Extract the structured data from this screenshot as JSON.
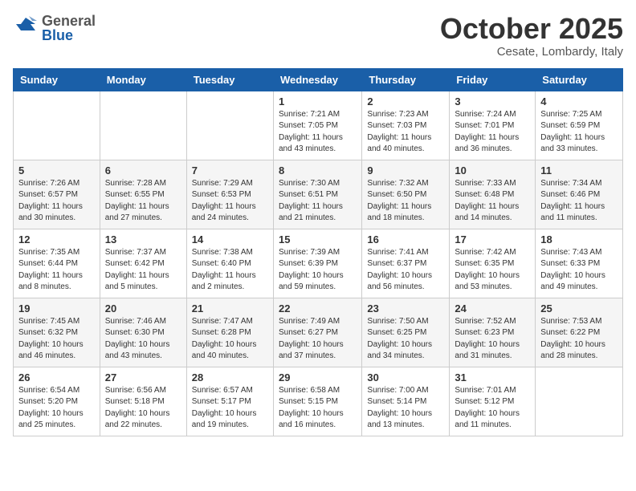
{
  "header": {
    "logo_general": "General",
    "logo_blue": "Blue",
    "month": "October 2025",
    "location": "Cesate, Lombardy, Italy"
  },
  "weekdays": [
    "Sunday",
    "Monday",
    "Tuesday",
    "Wednesday",
    "Thursday",
    "Friday",
    "Saturday"
  ],
  "weeks": [
    [
      {
        "day": "",
        "info": ""
      },
      {
        "day": "",
        "info": ""
      },
      {
        "day": "",
        "info": ""
      },
      {
        "day": "1",
        "info": "Sunrise: 7:21 AM\nSunset: 7:05 PM\nDaylight: 11 hours\nand 43 minutes."
      },
      {
        "day": "2",
        "info": "Sunrise: 7:23 AM\nSunset: 7:03 PM\nDaylight: 11 hours\nand 40 minutes."
      },
      {
        "day": "3",
        "info": "Sunrise: 7:24 AM\nSunset: 7:01 PM\nDaylight: 11 hours\nand 36 minutes."
      },
      {
        "day": "4",
        "info": "Sunrise: 7:25 AM\nSunset: 6:59 PM\nDaylight: 11 hours\nand 33 minutes."
      }
    ],
    [
      {
        "day": "5",
        "info": "Sunrise: 7:26 AM\nSunset: 6:57 PM\nDaylight: 11 hours\nand 30 minutes."
      },
      {
        "day": "6",
        "info": "Sunrise: 7:28 AM\nSunset: 6:55 PM\nDaylight: 11 hours\nand 27 minutes."
      },
      {
        "day": "7",
        "info": "Sunrise: 7:29 AM\nSunset: 6:53 PM\nDaylight: 11 hours\nand 24 minutes."
      },
      {
        "day": "8",
        "info": "Sunrise: 7:30 AM\nSunset: 6:51 PM\nDaylight: 11 hours\nand 21 minutes."
      },
      {
        "day": "9",
        "info": "Sunrise: 7:32 AM\nSunset: 6:50 PM\nDaylight: 11 hours\nand 18 minutes."
      },
      {
        "day": "10",
        "info": "Sunrise: 7:33 AM\nSunset: 6:48 PM\nDaylight: 11 hours\nand 14 minutes."
      },
      {
        "day": "11",
        "info": "Sunrise: 7:34 AM\nSunset: 6:46 PM\nDaylight: 11 hours\nand 11 minutes."
      }
    ],
    [
      {
        "day": "12",
        "info": "Sunrise: 7:35 AM\nSunset: 6:44 PM\nDaylight: 11 hours\nand 8 minutes."
      },
      {
        "day": "13",
        "info": "Sunrise: 7:37 AM\nSunset: 6:42 PM\nDaylight: 11 hours\nand 5 minutes."
      },
      {
        "day": "14",
        "info": "Sunrise: 7:38 AM\nSunset: 6:40 PM\nDaylight: 11 hours\nand 2 minutes."
      },
      {
        "day": "15",
        "info": "Sunrise: 7:39 AM\nSunset: 6:39 PM\nDaylight: 10 hours\nand 59 minutes."
      },
      {
        "day": "16",
        "info": "Sunrise: 7:41 AM\nSunset: 6:37 PM\nDaylight: 10 hours\nand 56 minutes."
      },
      {
        "day": "17",
        "info": "Sunrise: 7:42 AM\nSunset: 6:35 PM\nDaylight: 10 hours\nand 53 minutes."
      },
      {
        "day": "18",
        "info": "Sunrise: 7:43 AM\nSunset: 6:33 PM\nDaylight: 10 hours\nand 49 minutes."
      }
    ],
    [
      {
        "day": "19",
        "info": "Sunrise: 7:45 AM\nSunset: 6:32 PM\nDaylight: 10 hours\nand 46 minutes."
      },
      {
        "day": "20",
        "info": "Sunrise: 7:46 AM\nSunset: 6:30 PM\nDaylight: 10 hours\nand 43 minutes."
      },
      {
        "day": "21",
        "info": "Sunrise: 7:47 AM\nSunset: 6:28 PM\nDaylight: 10 hours\nand 40 minutes."
      },
      {
        "day": "22",
        "info": "Sunrise: 7:49 AM\nSunset: 6:27 PM\nDaylight: 10 hours\nand 37 minutes."
      },
      {
        "day": "23",
        "info": "Sunrise: 7:50 AM\nSunset: 6:25 PM\nDaylight: 10 hours\nand 34 minutes."
      },
      {
        "day": "24",
        "info": "Sunrise: 7:52 AM\nSunset: 6:23 PM\nDaylight: 10 hours\nand 31 minutes."
      },
      {
        "day": "25",
        "info": "Sunrise: 7:53 AM\nSunset: 6:22 PM\nDaylight: 10 hours\nand 28 minutes."
      }
    ],
    [
      {
        "day": "26",
        "info": "Sunrise: 6:54 AM\nSunset: 5:20 PM\nDaylight: 10 hours\nand 25 minutes."
      },
      {
        "day": "27",
        "info": "Sunrise: 6:56 AM\nSunset: 5:18 PM\nDaylight: 10 hours\nand 22 minutes."
      },
      {
        "day": "28",
        "info": "Sunrise: 6:57 AM\nSunset: 5:17 PM\nDaylight: 10 hours\nand 19 minutes."
      },
      {
        "day": "29",
        "info": "Sunrise: 6:58 AM\nSunset: 5:15 PM\nDaylight: 10 hours\nand 16 minutes."
      },
      {
        "day": "30",
        "info": "Sunrise: 7:00 AM\nSunset: 5:14 PM\nDaylight: 10 hours\nand 13 minutes."
      },
      {
        "day": "31",
        "info": "Sunrise: 7:01 AM\nSunset: 5:12 PM\nDaylight: 10 hours\nand 11 minutes."
      },
      {
        "day": "",
        "info": ""
      }
    ]
  ]
}
